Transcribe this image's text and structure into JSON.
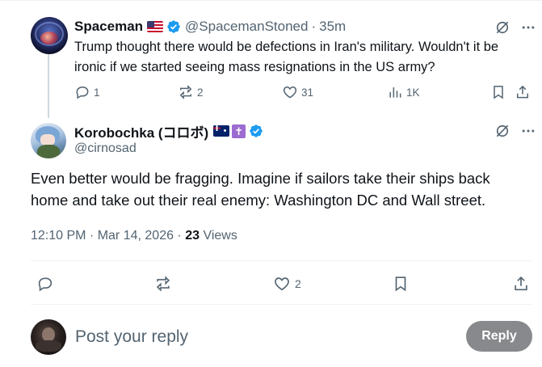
{
  "parent_tweet": {
    "author_name": "Spaceman",
    "author_flag": "flag-us-icon",
    "author_handle": "@SpacemanStoned",
    "separator": "·",
    "time_ago": "35m",
    "text": "Trump thought there would be defections in Iran's military. Wouldn't it be ironic if we started seeing mass resignations in the US army?",
    "stats": {
      "replies": "1",
      "reposts": "2",
      "likes": "31",
      "views": "1K"
    }
  },
  "main_tweet": {
    "author_name": "Korobochka (コロボ)",
    "author_badges": [
      "flag-au-icon",
      "cross-icon"
    ],
    "cross_glyph": "✝",
    "author_handle": "@cirnosad",
    "text": "Even better would be fragging. Imagine if sailors take their ships back home and take out their real enemy: Washington DC and Wall street.",
    "timestamp": "12:10 PM · Mar 14, 2026 · ",
    "views_count": "23",
    "views_label": " Views",
    "stats": {
      "likes": "2"
    }
  },
  "reply_box": {
    "placeholder": "Post your reply",
    "button_label": "Reply"
  },
  "colors": {
    "text": "#0f1419",
    "muted": "#536471",
    "verified": "#1d9bf0",
    "reply_button": "#87898c",
    "divider": "#eff3f4"
  }
}
